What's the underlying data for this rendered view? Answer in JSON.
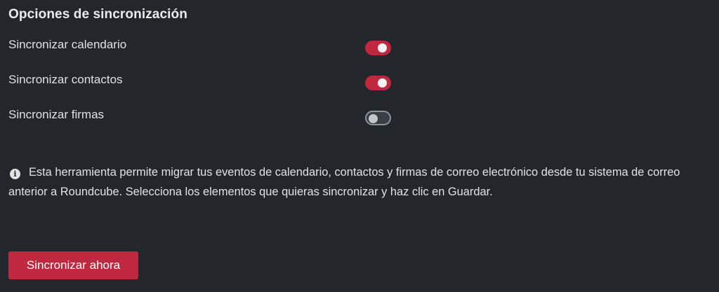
{
  "section": {
    "title": "Opciones de sincronización"
  },
  "options": [
    {
      "label": "Sincronizar calendario",
      "enabled": true
    },
    {
      "label": "Sincronizar contactos",
      "enabled": true
    },
    {
      "label": "Sincronizar firmas",
      "enabled": false
    }
  ],
  "info": {
    "icon": "info-icon",
    "text": "Esta herramienta permite migrar tus eventos de calendario, contactos y firmas de correo electrónico desde tu sistema de correo anterior a Roundcube. Selecciona los elementos que quieras sincronizar y haz clic en Guardar."
  },
  "actions": {
    "sync_now_label": "Sincronizar ahora"
  },
  "colors": {
    "background": "#23272b",
    "accent": "#c0283f",
    "toggle_off_border": "#8d9399"
  }
}
